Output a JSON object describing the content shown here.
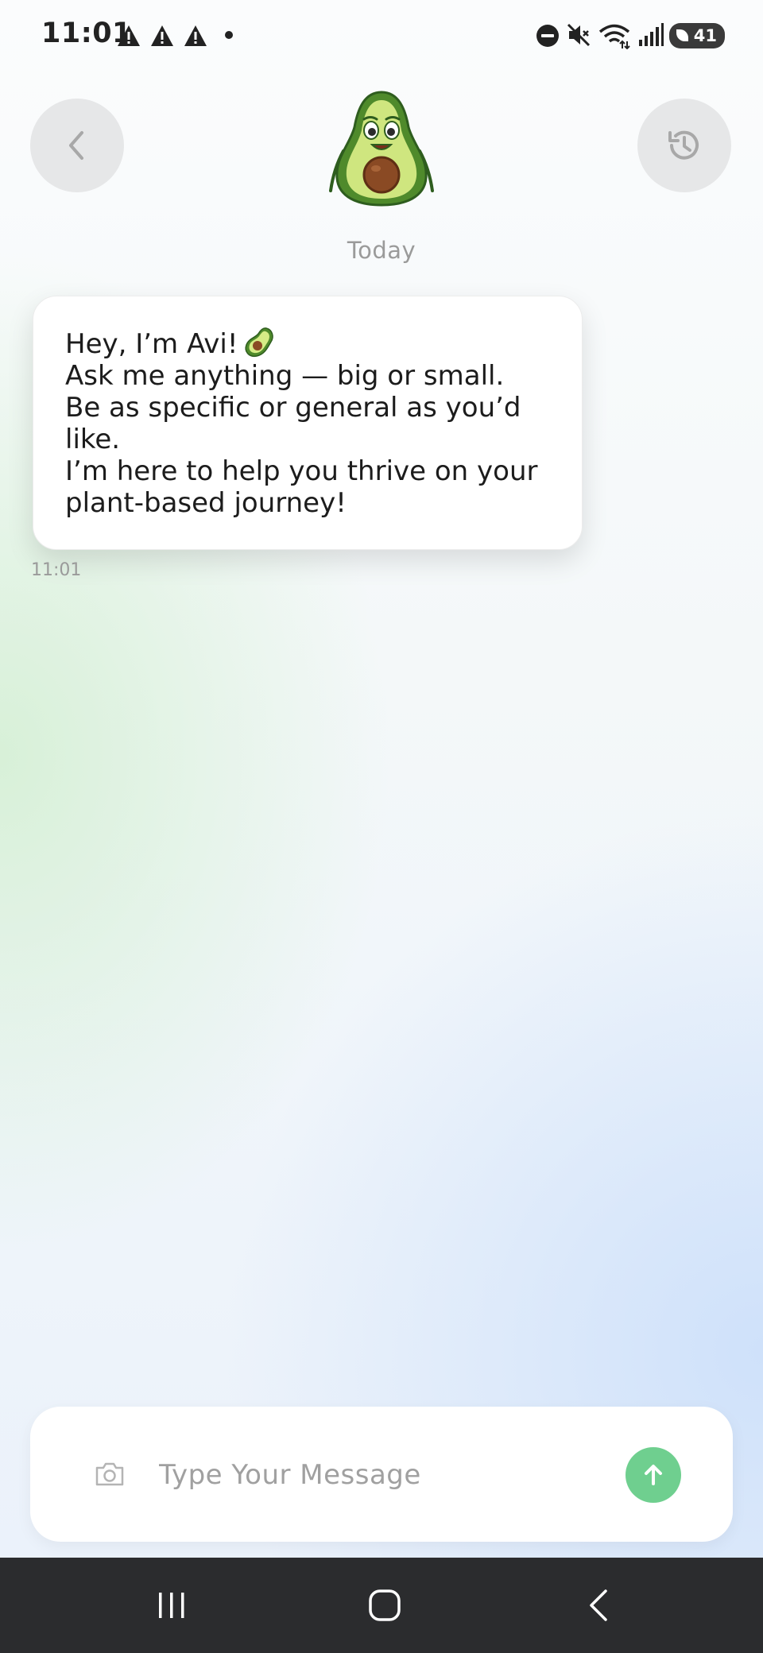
{
  "status_bar": {
    "time": "11:01",
    "battery_level": "41",
    "icons": [
      "warning-icon",
      "warning-icon",
      "warning-icon",
      "notification-dot",
      "do-not-disturb-icon",
      "mute-icon",
      "wifi-icon",
      "signal-icon",
      "battery-icon"
    ]
  },
  "header": {
    "back_icon": "chevron-left-icon",
    "history_icon": "history-icon",
    "mascot": "avocado-mascot"
  },
  "chat": {
    "date_label": "Today",
    "messages": [
      {
        "lines": [
          "Hey, I’m Avi!",
          "Ask me anything — big or small.",
          "Be as specific or general as you’d",
          "like.",
          "I’m here to help you thrive on your",
          "plant-based journey!"
        ],
        "emoji": "avocado-emoji",
        "time": "11:01"
      }
    ]
  },
  "composer": {
    "placeholder": "Type Your Message",
    "camera_icon": "camera-icon",
    "send_icon": "arrow-up-icon"
  },
  "colors": {
    "accent": "#6fcf8f",
    "button_bg": "#e6e7e8",
    "nav_bg": "#2b2c2e"
  }
}
